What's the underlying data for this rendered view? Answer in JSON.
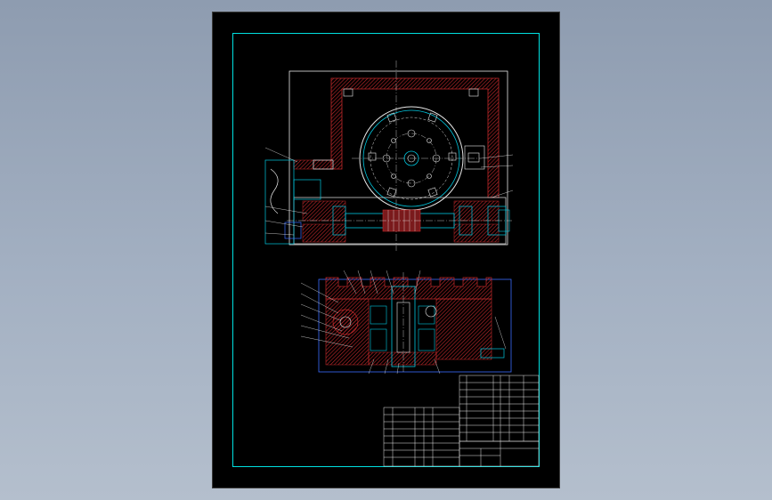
{
  "viewer": {
    "background_top": "#8e9cb0",
    "background_bottom": "#b4bfcd"
  },
  "drawing": {
    "sheet_color": "#000000",
    "frame_color": "#00e0e0",
    "outline_color": "#e8e8e8",
    "hatch_color": "#c0282a",
    "center_line_color": "#e8e8e8",
    "detail_color": "#00c8e0",
    "highlight_color": "#3a6cff",
    "title_block": {
      "drawing_title": "",
      "notes": []
    }
  }
}
